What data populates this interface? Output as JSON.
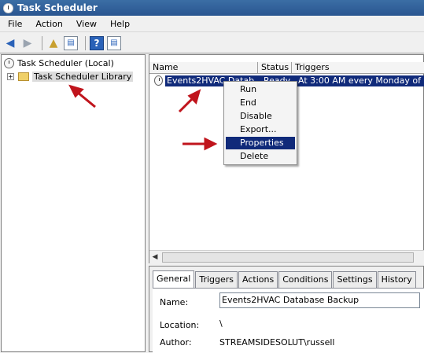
{
  "window": {
    "title": "Task Scheduler"
  },
  "menu": [
    "File",
    "Action",
    "View",
    "Help"
  ],
  "toolbar": {
    "icons": [
      "back-arrow-icon",
      "forward-arrow-icon",
      "up-folder-icon",
      "show-hide-console-tree-icon",
      "help-icon",
      "show-hide-action-pane-icon"
    ]
  },
  "tree": {
    "root": "Task Scheduler (Local)",
    "library": "Task Scheduler Library",
    "expander": "+"
  },
  "task_list": {
    "columns": [
      "Name",
      "Status",
      "Triggers"
    ],
    "rows": [
      {
        "name": "Events2HVAC Datab...",
        "status": "Ready",
        "triggers": "At 3:00 AM every Monday of ..."
      }
    ]
  },
  "context_menu": {
    "items": [
      "Run",
      "End",
      "Disable",
      "Export...",
      "Properties",
      "Delete"
    ],
    "highlighted": "Properties"
  },
  "details": {
    "tabs": [
      "General",
      "Triggers",
      "Actions",
      "Conditions",
      "Settings",
      "History"
    ],
    "active_tab": "General",
    "name_label": "Name:",
    "name_value": "Events2HVAC Database Backup",
    "location_label": "Location:",
    "location_value": "\\",
    "author_label": "Author:",
    "author_value": "STREAMSIDESOLUT\\russell"
  },
  "colors": {
    "annotation_arrow": "#c0141c",
    "selection": "#102a7a"
  }
}
